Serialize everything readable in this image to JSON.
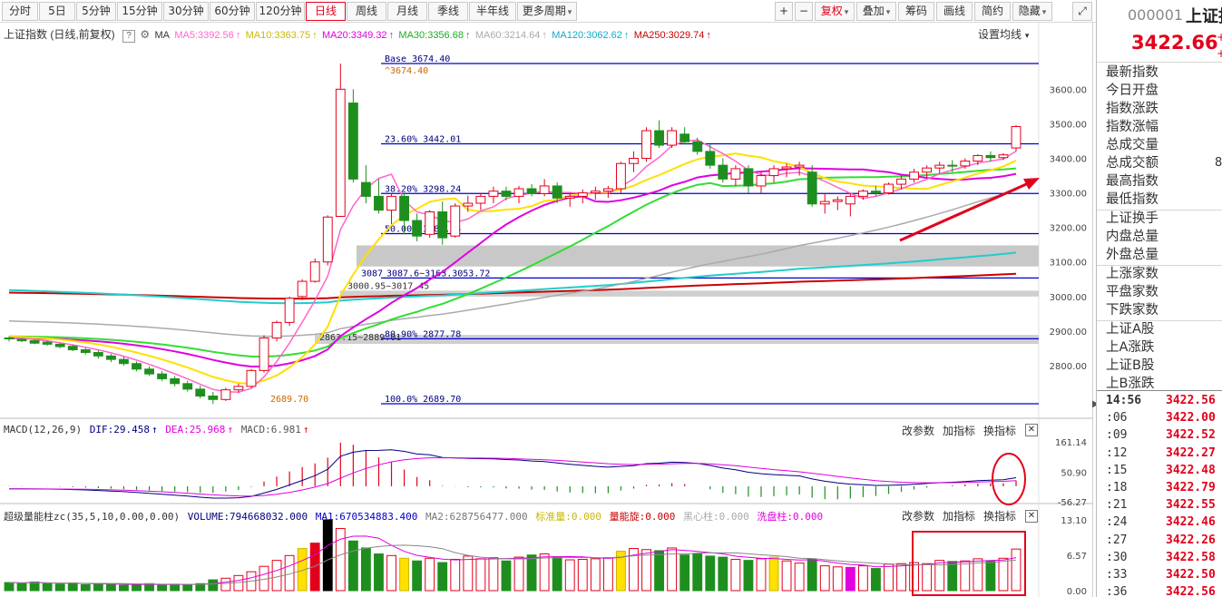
{
  "toolbar": {
    "periods": [
      "分时",
      "5日",
      "5分钟",
      "15分钟",
      "30分钟",
      "60分钟",
      "120分钟",
      "日线",
      "周线",
      "月线",
      "季线",
      "半年线",
      "更多周期"
    ],
    "active_period": "日线",
    "plus": "+",
    "minus": "−",
    "fuquan": "复权",
    "diejia": "叠加",
    "choumа": "筹码",
    "huaxian": "画线",
    "jianyue": "简约",
    "yincang": "隐藏",
    "dropdown_arrow": "▾"
  },
  "main_legend": {
    "title": "上证指数 (日线,前复权)",
    "help": "?",
    "ma_label": "MA",
    "ma5": "MA5:3392.56",
    "ma10": "MA10:3363.75",
    "ma20": "MA20:3349.32",
    "ma30": "MA30:3356.68",
    "ma60": "MA60:3214.64",
    "ma120": "MA120:3062.62",
    "ma250": "MA250:3029.74",
    "settings": "设置均线"
  },
  "fib_labels": {
    "base": "Base   3674.40",
    "high": "^3674.40",
    "f236": "23.60% 3442.01",
    "f382": "38.20% 3298.24",
    "f500": "50.00% 3182.05",
    "f618": "3087.6~3163.3053.72",
    "f809": "80.90% 2877.78",
    "f100": "100.0% 2689.70",
    "low": "2689.70",
    "gap1": "3000.95~3017.45",
    "gap2": "2863.15~2889.01",
    "prefix618": "3087"
  },
  "price_axis": [
    "3600.00",
    "3500.00",
    "3400.00",
    "3300.00",
    "3200.00",
    "3100.00",
    "3000.00",
    "2900.00",
    "2800.00"
  ],
  "macd_legend": {
    "name": "MACD(12,26,9)",
    "dif": "DIF:29.458",
    "dea": "DEA:25.968",
    "macd": "MACD:6.981",
    "axis": [
      "161.14",
      "50.90",
      "-56.27"
    ]
  },
  "vol_legend": {
    "name": "超级量能柱zc(35,5,10,0.00,0.00)",
    "volume": "VOLUME:794668032.000",
    "ma1": "MA1:670534883.400",
    "ma2": "MA2:628756477.000",
    "biaozhun": "标准量:0.000",
    "liangnengxuan": "量能旋:0.000",
    "heixinzhu": "黑心柱:0.000",
    "xipanzhu": "洗盘柱:0.000",
    "axis": [
      "13.10",
      "6.57",
      "0.00"
    ]
  },
  "panel_buttons": {
    "gai": "改参数",
    "jia": "加指标",
    "huan": "换指标",
    "close": "✕"
  },
  "arrow_up": "↑",
  "right_panel": {
    "code": "000001",
    "name": "上证指数",
    "price": "3422.66",
    "labels": [
      "最新指数",
      "今日开盘",
      "指数涨跌",
      "指数涨幅",
      "总成交量",
      "总成交额",
      "最高指数",
      "最低指数",
      "上证换手",
      "内盘总量",
      "外盘总量",
      "上涨家数",
      "平盘家数",
      "下跌家数",
      "上证A股",
      "上A涨跌",
      "上证B股",
      "上B涨跌"
    ],
    "partial_value": "8",
    "ticks": [
      {
        "t": "14:56",
        "v": "3422.56"
      },
      {
        "t": ":06",
        "v": "3422.00"
      },
      {
        "t": ":09",
        "v": "3422.52"
      },
      {
        "t": ":12",
        "v": "3422.27"
      },
      {
        "t": ":15",
        "v": "3422.48"
      },
      {
        "t": ":18",
        "v": "3422.79"
      },
      {
        "t": ":21",
        "v": "3422.55"
      },
      {
        "t": ":24",
        "v": "3422.46"
      },
      {
        "t": ":27",
        "v": "3422.26"
      },
      {
        "t": ":30",
        "v": "3422.58"
      },
      {
        "t": ":33",
        "v": "3422.50"
      },
      {
        "t": ":36",
        "v": "3422.56"
      }
    ]
  },
  "colors": {
    "up": "#e3001b",
    "down": "#1e8f1e",
    "ma5": "#ff66cc",
    "ma10": "#ffe000",
    "ma20": "#e000e0",
    "ma30": "#33dd33",
    "ma60": "#aaaaaa",
    "ma120": "#22cccc",
    "ma250": "#cc0000",
    "fib": "#0000cc"
  },
  "chart_data": {
    "type": "candlestick",
    "price_range": [
      2689.7,
      3674.4
    ],
    "candles_ohlc": [
      [
        2880,
        2885,
        2870,
        2878
      ],
      [
        2876,
        2880,
        2868,
        2872
      ],
      [
        2872,
        2875,
        2862,
        2865
      ],
      [
        2868,
        2872,
        2858,
        2862
      ],
      [
        2862,
        2866,
        2850,
        2855
      ],
      [
        2856,
        2860,
        2842,
        2846
      ],
      [
        2846,
        2852,
        2832,
        2838
      ],
      [
        2838,
        2844,
        2820,
        2828
      ],
      [
        2828,
        2834,
        2810,
        2818
      ],
      [
        2818,
        2826,
        2800,
        2806
      ],
      [
        2806,
        2812,
        2784,
        2790
      ],
      [
        2790,
        2798,
        2770,
        2776
      ],
      [
        2776,
        2784,
        2755,
        2762
      ],
      [
        2762,
        2770,
        2740,
        2748
      ],
      [
        2748,
        2756,
        2725,
        2732
      ],
      [
        2732,
        2742,
        2705,
        2712
      ],
      [
        2712,
        2724,
        2689,
        2702
      ],
      [
        2702,
        2736,
        2698,
        2730
      ],
      [
        2730,
        2748,
        2722,
        2740
      ],
      [
        2740,
        2790,
        2736,
        2786
      ],
      [
        2786,
        2888,
        2780,
        2880
      ],
      [
        2880,
        2930,
        2870,
        2925
      ],
      [
        2925,
        3000,
        2915,
        2995
      ],
      [
        3000,
        3050,
        2990,
        3044
      ],
      [
        3044,
        3110,
        3040,
        3100
      ],
      [
        3100,
        3235,
        3090,
        3230
      ],
      [
        3232,
        3674,
        3232,
        3600
      ],
      [
        3560,
        3600,
        3330,
        3340
      ],
      [
        3330,
        3380,
        3270,
        3290
      ],
      [
        3290,
        3340,
        3240,
        3250
      ],
      [
        3250,
        3300,
        3210,
        3290
      ],
      [
        3290,
        3300,
        3180,
        3220
      ],
      [
        3220,
        3240,
        3160,
        3175
      ],
      [
        3180,
        3250,
        3170,
        3245
      ],
      [
        3245,
        3275,
        3150,
        3170
      ],
      [
        3175,
        3270,
        3170,
        3262
      ],
      [
        3262,
        3292,
        3245,
        3270
      ],
      [
        3270,
        3300,
        3250,
        3290
      ],
      [
        3290,
        3318,
        3270,
        3305
      ],
      [
        3305,
        3318,
        3278,
        3290
      ],
      [
        3290,
        3320,
        3270,
        3312
      ],
      [
        3312,
        3325,
        3290,
        3298
      ],
      [
        3298,
        3340,
        3290,
        3320
      ],
      [
        3320,
        3330,
        3270,
        3285
      ],
      [
        3285,
        3300,
        3260,
        3290
      ],
      [
        3290,
        3310,
        3270,
        3300
      ],
      [
        3300,
        3318,
        3280,
        3305
      ],
      [
        3305,
        3320,
        3286,
        3312
      ],
      [
        3312,
        3390,
        3300,
        3385
      ],
      [
        3385,
        3420,
        3360,
        3400
      ],
      [
        3400,
        3490,
        3390,
        3480
      ],
      [
        3480,
        3510,
        3430,
        3438
      ],
      [
        3438,
        3490,
        3430,
        3480
      ],
      [
        3470,
        3490,
        3440,
        3448
      ],
      [
        3448,
        3460,
        3410,
        3420
      ],
      [
        3420,
        3440,
        3370,
        3380
      ],
      [
        3380,
        3400,
        3330,
        3340
      ],
      [
        3340,
        3380,
        3320,
        3370
      ],
      [
        3370,
        3380,
        3300,
        3320
      ],
      [
        3320,
        3360,
        3300,
        3350
      ],
      [
        3350,
        3380,
        3330,
        3370
      ],
      [
        3370,
        3385,
        3345,
        3375
      ],
      [
        3375,
        3390,
        3350,
        3380
      ],
      [
        3360,
        3380,
        3260,
        3268
      ],
      [
        3268,
        3300,
        3240,
        3275
      ],
      [
        3275,
        3290,
        3250,
        3280
      ],
      [
        3268,
        3300,
        3232,
        3290
      ],
      [
        3290,
        3310,
        3280,
        3305
      ],
      [
        3305,
        3320,
        3290,
        3300
      ],
      [
        3300,
        3330,
        3295,
        3325
      ],
      [
        3325,
        3350,
        3310,
        3340
      ],
      [
        3340,
        3370,
        3330,
        3360
      ],
      [
        3360,
        3380,
        3345,
        3372
      ],
      [
        3372,
        3390,
        3355,
        3380
      ],
      [
        3380,
        3395,
        3360,
        3378
      ],
      [
        3378,
        3400,
        3370,
        3392
      ],
      [
        3392,
        3412,
        3380,
        3408
      ],
      [
        3408,
        3420,
        3390,
        3402
      ],
      [
        3402,
        3415,
        3395,
        3410
      ],
      [
        3430,
        3496,
        3420,
        3492
      ]
    ],
    "volume": [
      1.5,
      1.4,
      1.6,
      1.3,
      1.2,
      1.4,
      1.1,
      1.3,
      1.2,
      1.0,
      1.1,
      1.3,
      1.0,
      1.2,
      1.1,
      1.3,
      2.0,
      2.3,
      2.8,
      3.5,
      4.5,
      5.6,
      6.5,
      7.8,
      8.8,
      13.1,
      11.5,
      9.2,
      7.9,
      6.8,
      6.5,
      6.0,
      5.5,
      6.0,
      5.2,
      5.8,
      6.4,
      5.9,
      6.1,
      5.5,
      6.2,
      6.6,
      6.8,
      6.3,
      5.7,
      5.8,
      5.9,
      6.1,
      7.3,
      7.8,
      7.6,
      7.4,
      7.9,
      6.6,
      6.9,
      6.4,
      6.2,
      5.8,
      5.6,
      5.9,
      6.2,
      5.5,
      5.1,
      5.9,
      4.6,
      4.4,
      4.3,
      4.6,
      4.1,
      4.9,
      5.0,
      5.2,
      5.0,
      5.6,
      5.4,
      5.5,
      5.9,
      5.5,
      6.0,
      7.7
    ],
    "vol_axis": [
      0.0,
      13.1
    ],
    "macd_range": [
      -56.27,
      161.14
    ]
  }
}
